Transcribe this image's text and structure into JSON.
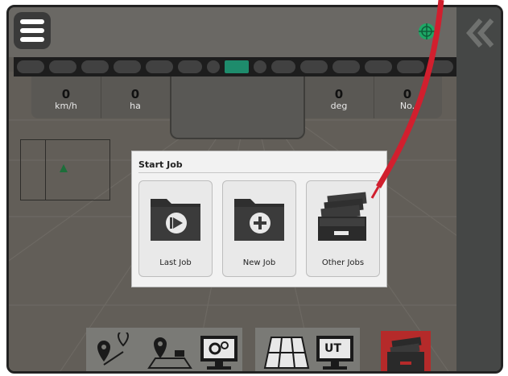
{
  "colors": {
    "accent_red": "#d11f2e",
    "led_active": "#1e8c6c",
    "dialog_bg": "#f2f2f2",
    "red_tile": "#b52a2a"
  },
  "header": {
    "menu_icon": "hamburger-icon",
    "status_icon": "gps-globe-icon",
    "collapse_icon": "double-chevron-left-icon"
  },
  "metrics": [
    {
      "value": "0",
      "unit": "km/h"
    },
    {
      "value": "0",
      "unit": "ha"
    },
    {
      "value": "0",
      "unit": "deg"
    },
    {
      "value": "0",
      "unit": "No."
    }
  ],
  "dialog": {
    "title": "Start Job",
    "buttons": [
      {
        "label": "Last Job",
        "icon": "folder-play-icon"
      },
      {
        "label": "New Job",
        "icon": "folder-add-icon"
      },
      {
        "label": "Other Jobs",
        "icon": "file-drawer-icon"
      }
    ]
  },
  "bottom_bar": {
    "icons": [
      "route-points-icon",
      "field-location-icon",
      "settings-monitor-icon",
      "grid-map-icon",
      "ut-monitor-icon",
      "job-drawer-icon"
    ],
    "ut_label": "UT"
  }
}
